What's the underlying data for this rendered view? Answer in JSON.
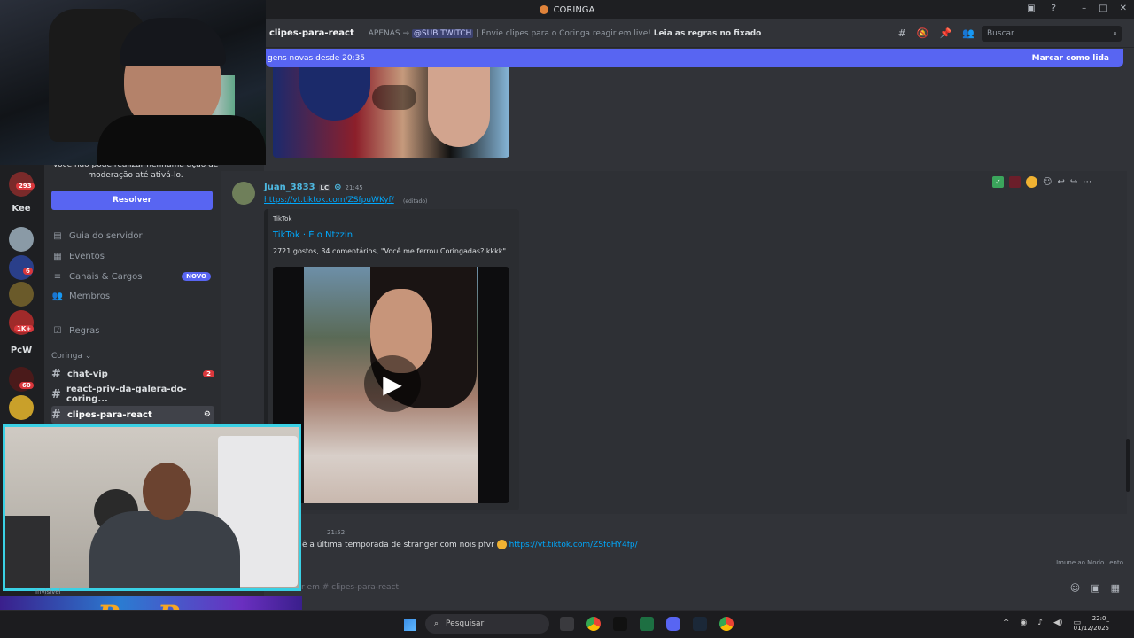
{
  "window": {
    "title": "CORINGA"
  },
  "header": {
    "channel_name": "clipes-para-react",
    "topic_prefix": "APENAS →",
    "topic_mention": "@SUB TWITCH",
    "topic_sep": "|",
    "topic_text": "Envie clipes para o Coringa reagir em live!",
    "topic_bold": "Leia as regras no fixado",
    "search_placeholder": "Buscar"
  },
  "new_messages_bar": {
    "text": "gens novas desde 20:35",
    "action": "Marcar como lida"
  },
  "sidebar": {
    "notice": "Você não pode realizar nenhuma ação de moderação até ativá-lo.",
    "resolve_button": "Resolver",
    "nav": [
      {
        "label": "Guia do servidor",
        "icon": "guide-icon"
      },
      {
        "label": "Eventos",
        "icon": "calendar-icon"
      },
      {
        "label": "Canais & Cargos",
        "icon": "channels-icon",
        "badge": "NOVO"
      },
      {
        "label": "Membros",
        "icon": "members-icon"
      },
      {
        "label": "Regras",
        "icon": "rules-icon"
      }
    ],
    "category": "Coringa",
    "channels": [
      {
        "name": "chat-vip",
        "badge": "2"
      },
      {
        "name": "react-priv-da-galera-do-coring..."
      },
      {
        "name": "clipes-para-react",
        "active": true
      }
    ]
  },
  "rail": {
    "badges": [
      "293",
      "6",
      "1K+",
      "60"
    ],
    "text_items": [
      "Kee",
      "PcW"
    ]
  },
  "message1": {
    "author": "Juan_3833",
    "tag": "LC",
    "time": "21:45",
    "link": "https://vt.tiktok.com/ZSfpuWKyf/",
    "edited": "(editado)",
    "embed": {
      "provider": "TikTok",
      "title": "TikTok · É o Ntzzin",
      "description": "2721 gostos, 34 comentários, \"Você me ferrou Coringadas? kkkk\""
    }
  },
  "message2": {
    "time": "21:52",
    "text": "ê a última temporada de stranger com nois pfvr",
    "link": "https://vt.tiktok.com/ZSfoHY4fp/"
  },
  "slowmode": "Imune ao Modo Lento",
  "composer": {
    "placeholder": "r em #",
    "channel": "clipes-para-react"
  },
  "overlay": {
    "logo_text": "PeoPoox",
    "status": "Invisível"
  },
  "taskbar": {
    "search_placeholder": "Pesquisar",
    "time": "22:0_",
    "date": "01/12/2025"
  }
}
